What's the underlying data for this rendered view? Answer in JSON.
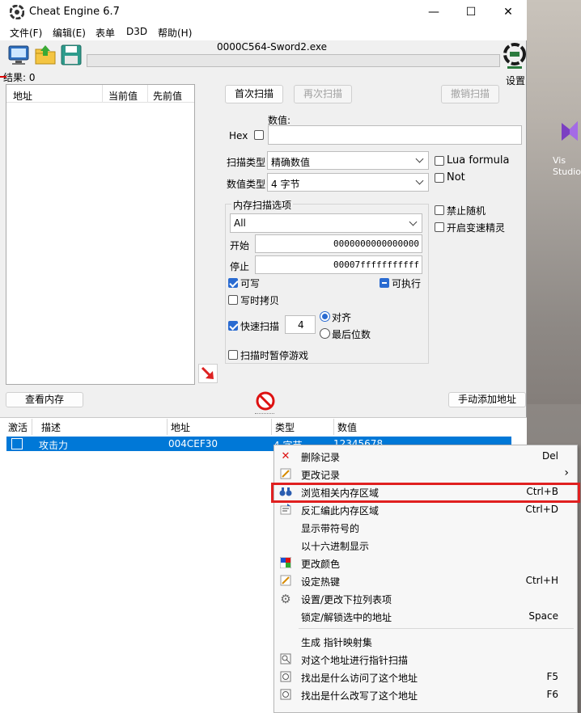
{
  "window": {
    "title": "Cheat Engine 6.7",
    "process": "0000C564-Sword2.exe",
    "minimize": "—",
    "maximize": "☐",
    "close": "✕"
  },
  "menu": [
    "文件(F)",
    "编辑(E)",
    "表单",
    "D3D",
    "帮助(H)"
  ],
  "toolbar": {
    "settings_label": "设置"
  },
  "results": {
    "label": "结果: 0"
  },
  "found_list": {
    "col_address": "地址",
    "col_current": "当前值",
    "col_previous": "先前值"
  },
  "scan": {
    "first_scan": "首次扫描",
    "next_scan": "再次扫描",
    "undo_scan": "撤销扫描",
    "value_label": "数值:",
    "hex_label": "Hex",
    "scan_type_label": "扫描类型",
    "scan_type_value": "精确数值",
    "value_type_label": "数值类型",
    "value_type_value": "4 字节",
    "lua_formula": "Lua formula",
    "not_label": "Not",
    "memory_options_label": "内存扫描选项",
    "memory_region": "All",
    "start_label": "开始",
    "start_value": "0000000000000000",
    "stop_label": "停止",
    "stop_value": "00007fffffffffff",
    "writable": "可写",
    "executable": "可执行",
    "copy_on_write": "写时拷贝",
    "fast_scan": "快速扫描",
    "fast_scan_value": "4",
    "align": "对齐",
    "last_digits": "最后位数",
    "pause_game": "扫描时暂停游戏",
    "disable_random": "禁止随机",
    "speedhack": "开启变速精灵"
  },
  "bottom_buttons": {
    "view_memory": "查看内存",
    "add_address": "手动添加地址"
  },
  "address_list": {
    "columns": [
      "激活",
      "描述",
      "地址",
      "类型",
      "数值"
    ],
    "rows": [
      {
        "active": false,
        "description": "攻击力",
        "address": "004CEF30",
        "type": "4 字节",
        "value": "12345678"
      }
    ]
  },
  "context_menu": {
    "items": [
      {
        "label": "删除记录",
        "shortcut": "Del",
        "icon": "delete-icon"
      },
      {
        "label": "更改记录",
        "shortcut": "›",
        "icon": "edit-icon"
      },
      {
        "label": "浏览相关内存区域",
        "shortcut": "Ctrl+B",
        "icon": "binoculars-icon"
      },
      {
        "label": "反汇编此内存区域",
        "shortcut": "Ctrl+D",
        "icon": "disassemble-icon"
      },
      {
        "label": "显示带符号的",
        "shortcut": "",
        "icon": ""
      },
      {
        "label": "以十六进制显示",
        "shortcut": "",
        "icon": ""
      },
      {
        "label": "更改颜色",
        "shortcut": "",
        "icon": "color-icon"
      },
      {
        "label": "设定热键",
        "shortcut": "Ctrl+H",
        "icon": "hotkey-icon"
      },
      {
        "label": "设置/更改下拉列表项",
        "shortcut": "",
        "icon": "gear-icon"
      },
      {
        "label": "锁定/解锁选中的地址",
        "shortcut": "Space",
        "icon": ""
      },
      {
        "label": "生成 指针映射集",
        "shortcut": "",
        "icon": ""
      },
      {
        "label": "对这个地址进行指针扫描",
        "shortcut": "",
        "icon": "pointer-scan-icon"
      },
      {
        "label": "找出是什么访问了这个地址",
        "shortcut": "F5",
        "icon": "access-icon"
      },
      {
        "label": "找出是什么改写了这个地址",
        "shortcut": "F6",
        "icon": "write-icon"
      }
    ]
  },
  "desktop": {
    "icon_label": "Vis Studio"
  }
}
